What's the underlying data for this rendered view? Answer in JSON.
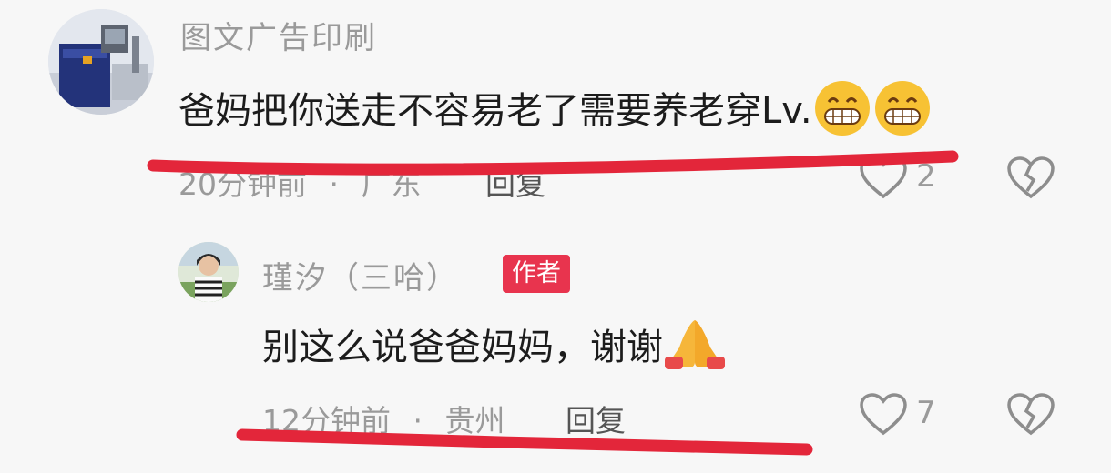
{
  "comments": [
    {
      "username": "图文广告印刷",
      "text": "爸妈把你送走不容易老了需要养老穿Lv.",
      "time": "20分钟前",
      "location": "广东",
      "reply_label": "回复",
      "like_count": "2",
      "emoji_icons": [
        "grinning-face-icon",
        "grinning-face-icon"
      ]
    }
  ],
  "reply": {
    "username": "瑾汐（三哈）",
    "author_badge": "作者",
    "text": "别这么说爸爸妈妈，谢谢",
    "time": "12分钟前",
    "separator": "·",
    "location": "贵州",
    "reply_label": "回复",
    "like_count": "7",
    "emoji_icons": [
      "folded-hands-icon"
    ]
  },
  "colors": {
    "badge": "#e8344e",
    "annotation_line": "#e3263a",
    "meta_text": "#9a9a9a"
  }
}
